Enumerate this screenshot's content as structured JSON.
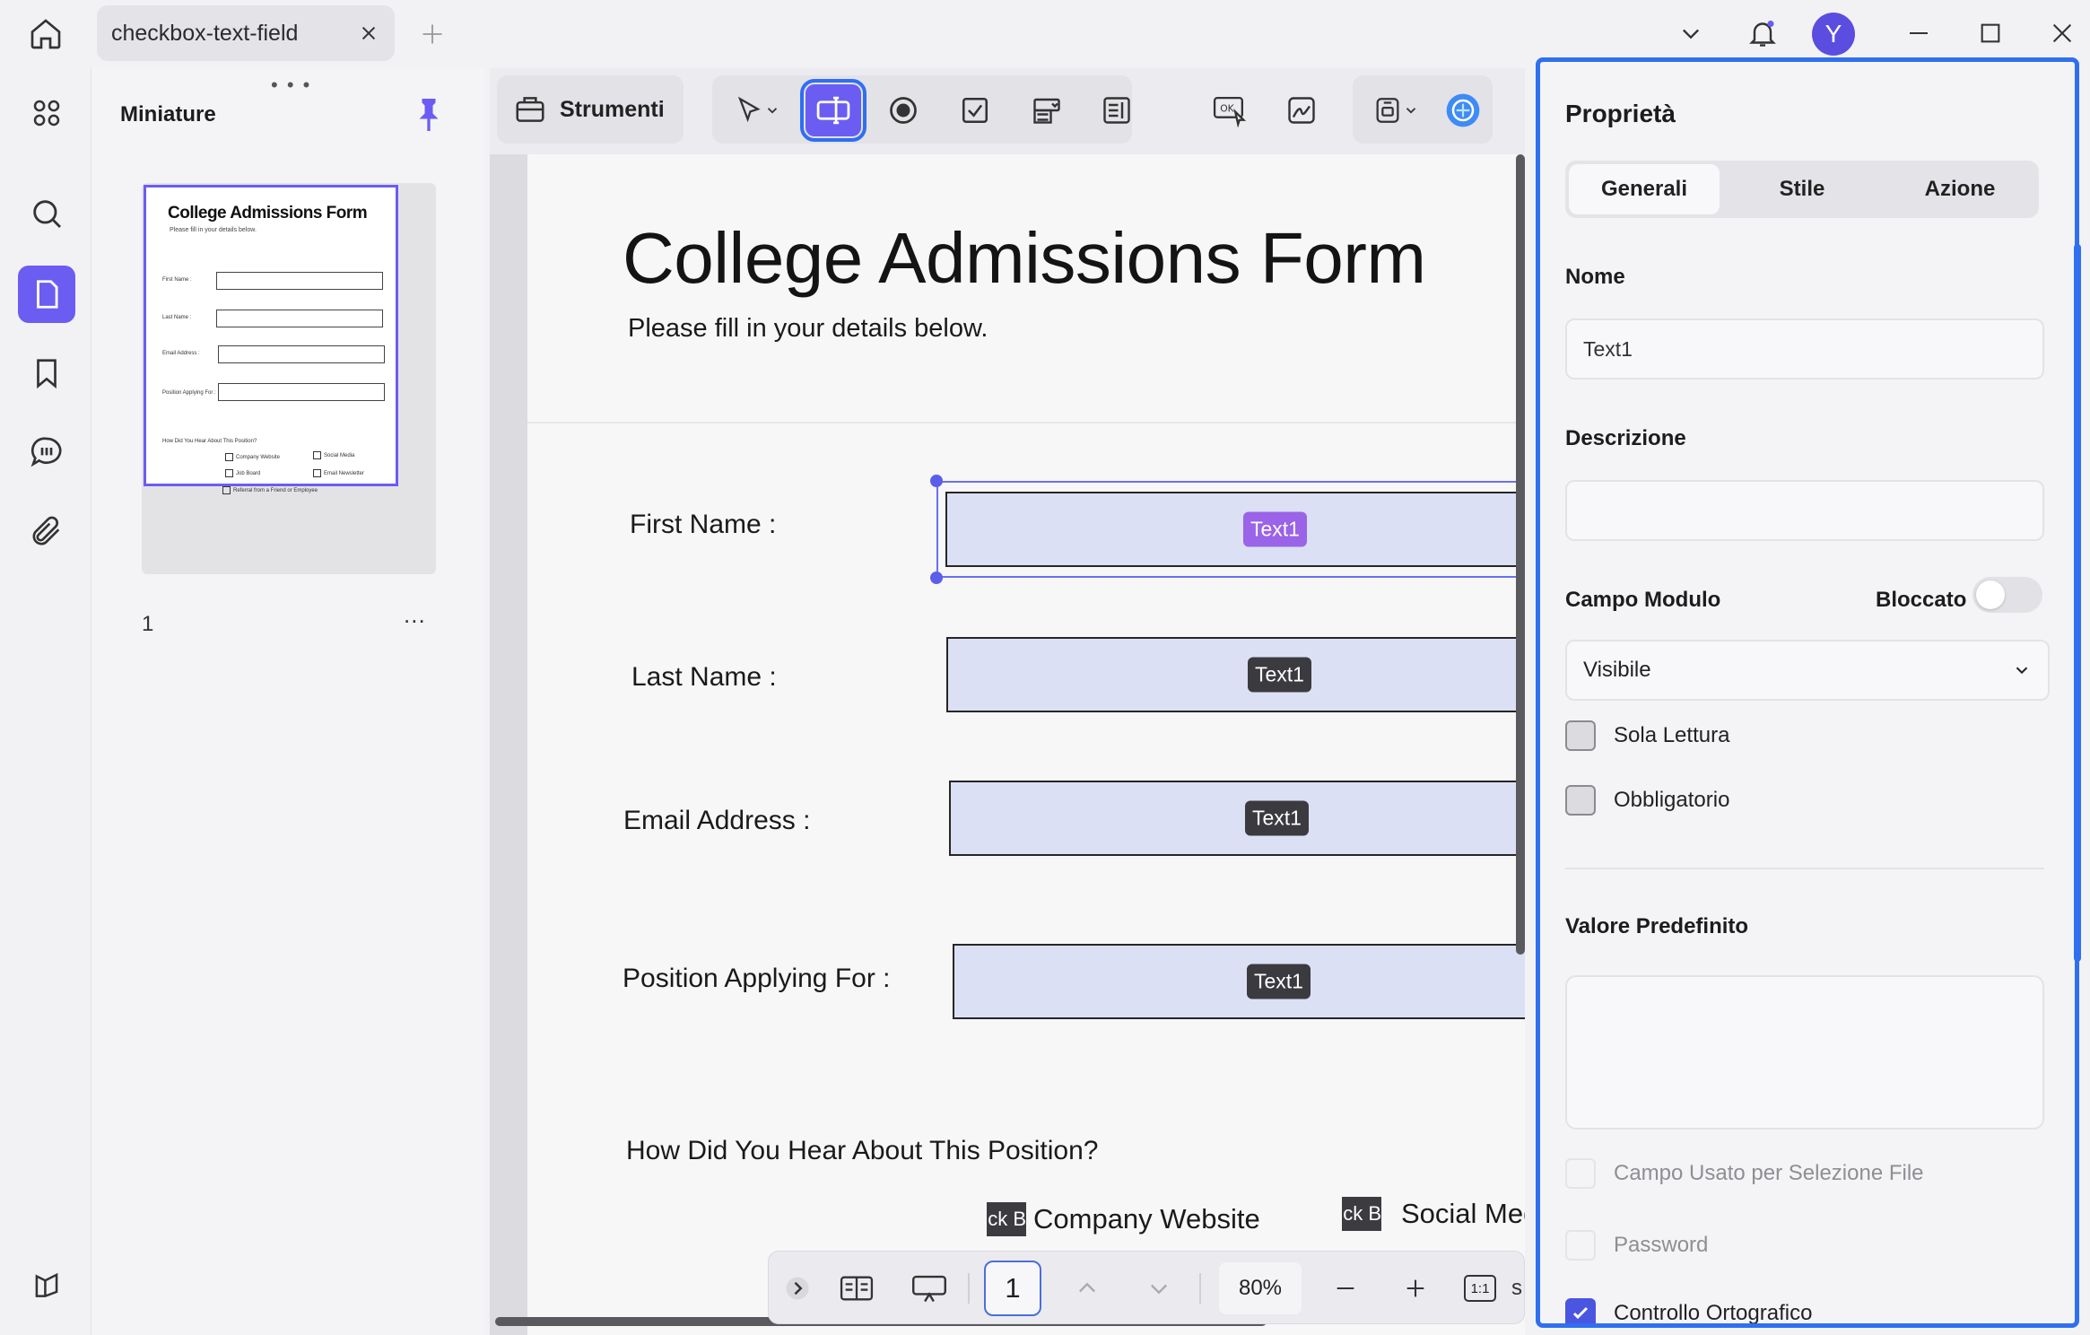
{
  "tab": {
    "title": "checkbox-text-field"
  },
  "user": {
    "avatar_initial": "Y"
  },
  "thumbnails": {
    "title": "Miniature",
    "page_label": "1",
    "more": "...",
    "preview": {
      "title": "College Admissions Form",
      "subtitle": "Please fill in your details below.",
      "fields": [
        "First Name :",
        "Last Name :",
        "Email Address :",
        "Position Applying For :"
      ],
      "question": "How Did You Hear About This Position?",
      "options": [
        "Company Website",
        "Social Media",
        "Job Board",
        "Email Newsletter",
        "Referral from a Friend or Employee"
      ]
    }
  },
  "toolbar": {
    "tools_label": "Strumenti"
  },
  "document": {
    "title": "College Admissions Form",
    "subtitle": "Please fill in your details below.",
    "fields": [
      {
        "label": "First Name :",
        "tag": "Text1"
      },
      {
        "label": "Last Name :",
        "tag": "Text1"
      },
      {
        "label": "Email Address :",
        "tag": "Text1"
      },
      {
        "label": "Position Applying For :",
        "tag": "Text1"
      }
    ],
    "question": "How Did You Hear About This Position?",
    "checkbox_tag": "ck B",
    "options": [
      "Company Website",
      "Social Medi"
    ]
  },
  "bottombar": {
    "page": "1",
    "zoom": "80%",
    "fit_label": "1:1",
    "trailing": "s"
  },
  "properties": {
    "title": "Proprietà",
    "tabs": [
      "Generali",
      "Stile",
      "Azione"
    ],
    "active_tab": "Generali",
    "name_label": "Nome",
    "name_value": "Text1",
    "description_label": "Descrizione",
    "description_value": "",
    "form_field_label": "Campo Modulo",
    "locked_label": "Bloccato",
    "locked": false,
    "visibility": "Visibile",
    "read_only_label": "Sola Lettura",
    "required_label": "Obbligatorio",
    "default_value_label": "Valore Predefinito",
    "default_value": "",
    "file_select_label": "Campo Usato per Selezione File",
    "password_label": "Password",
    "spellcheck_label": "Controllo Ortografico",
    "spellcheck": true
  },
  "colors": {
    "accent": "#6b5df2",
    "selection": "#2f6ff0",
    "field_fill": "#dbe0f5"
  }
}
